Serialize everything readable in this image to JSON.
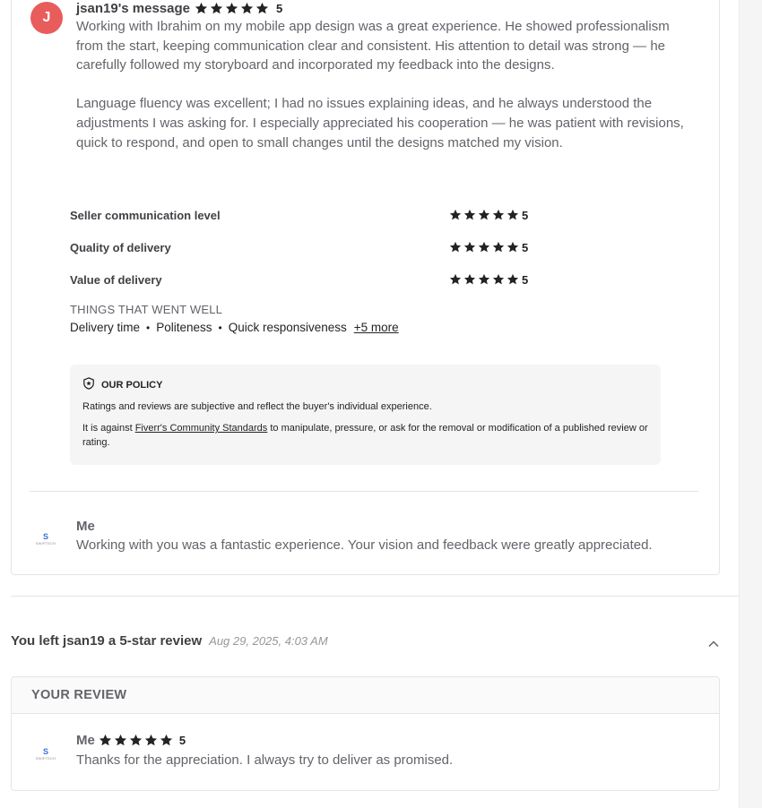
{
  "buyer_message": {
    "avatar_initial": "J",
    "author": "jsan19's message",
    "rating": "5",
    "paragraphs": [
      "Working with Ibrahim on my mobile app design was a great experience. He showed professionalism from the start, keeping communication clear and consistent. His attention to detail was strong — he carefully followed my storyboard and incorporated my feedback into the designs.",
      "Language fluency was excellent; I had no issues explaining ideas, and he always understood the adjustments I was asking for. I especially appreciated his cooperation — he was patient with revisions, quick to respond, and open to small changes until the designs matched my vision."
    ]
  },
  "ratings": [
    {
      "label": "Seller communication level",
      "score": "5"
    },
    {
      "label": "Quality of delivery",
      "score": "5"
    },
    {
      "label": "Value of delivery",
      "score": "5"
    }
  ],
  "went_well": {
    "title": "THINGS THAT WENT WELL",
    "items": [
      "Delivery time",
      "Politeness",
      "Quick responsiveness"
    ],
    "more": "+5 more"
  },
  "policy": {
    "title": "OUR POLICY",
    "line1": "Ratings and reviews are subjective and reflect the buyer's individual experience.",
    "line2_prefix": "It is against ",
    "line2_link": "Fiverr's Community Standards",
    "line2_suffix": " to manipulate, pressure, or ask for the removal or modification of a published review or rating."
  },
  "seller_reply": {
    "logo_text": "SWIFTECH",
    "name": "Me",
    "text": "Working with you was a fantastic experience. Your vision and feedback were greatly appreciated."
  },
  "left_review": {
    "title": "You left jsan19 a 5-star review",
    "date": "Aug 29, 2025, 4:03 AM"
  },
  "your_review": {
    "header": "YOUR REVIEW",
    "logo_text": "SWIFTECH",
    "name": "Me",
    "rating": "5",
    "text": "Thanks for the appreciation. I always try to deliver as promised."
  },
  "colors": {
    "avatar_bg": "#e85c5c",
    "star": "#222325",
    "logo_accent": "#3b6fd8"
  }
}
